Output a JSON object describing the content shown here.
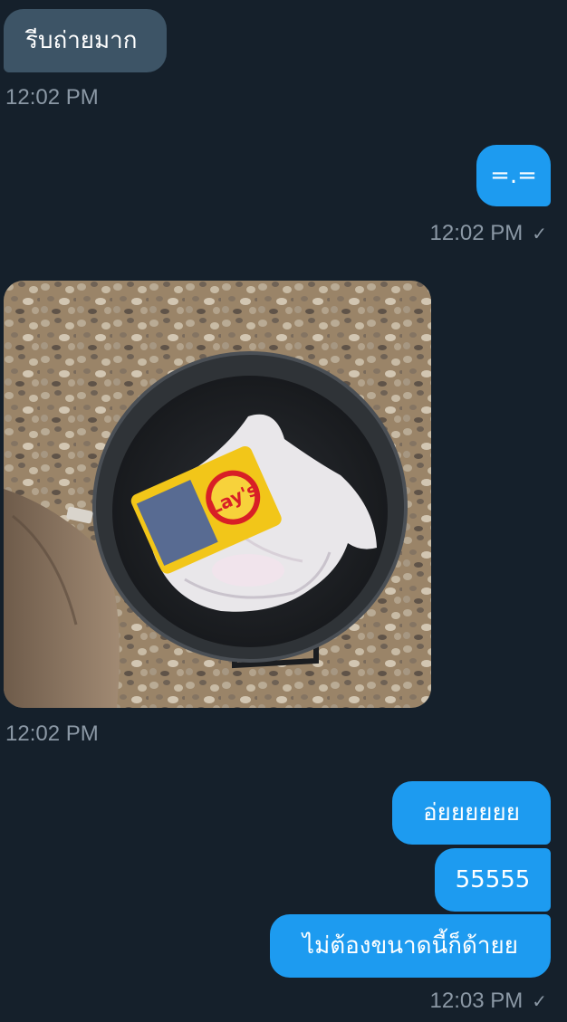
{
  "messages": [
    {
      "id": "m1",
      "direction": "received",
      "text": "รีบถ่ายมาก"
    },
    {
      "id": "m2",
      "direction": "sent",
      "text": "=.="
    },
    {
      "id": "m3",
      "direction": "received",
      "type": "photo",
      "photo_description": "black bucket with plastic bag and Lay's chips packet on gravel"
    },
    {
      "id": "m4",
      "direction": "sent",
      "text": "อ่ยยยยยย"
    },
    {
      "id": "m5",
      "direction": "sent",
      "text": "55555"
    },
    {
      "id": "m6",
      "direction": "sent",
      "text": "ไม่ต้องขนาดนี้ก็ด้ายย"
    }
  ],
  "timestamps": {
    "t1": "12:02 PM",
    "t2": "12:02 PM",
    "t3": "12:02 PM",
    "t4": "12:03 PM"
  },
  "photo": {
    "packet_brand": "Lay's"
  },
  "colors": {
    "background": "#15202b",
    "received_bubble": "#3d5466",
    "sent_bubble": "#1d9bf0",
    "timestamp": "#8b98a5"
  },
  "icons": {
    "read_receipt": "checkmark-icon"
  }
}
